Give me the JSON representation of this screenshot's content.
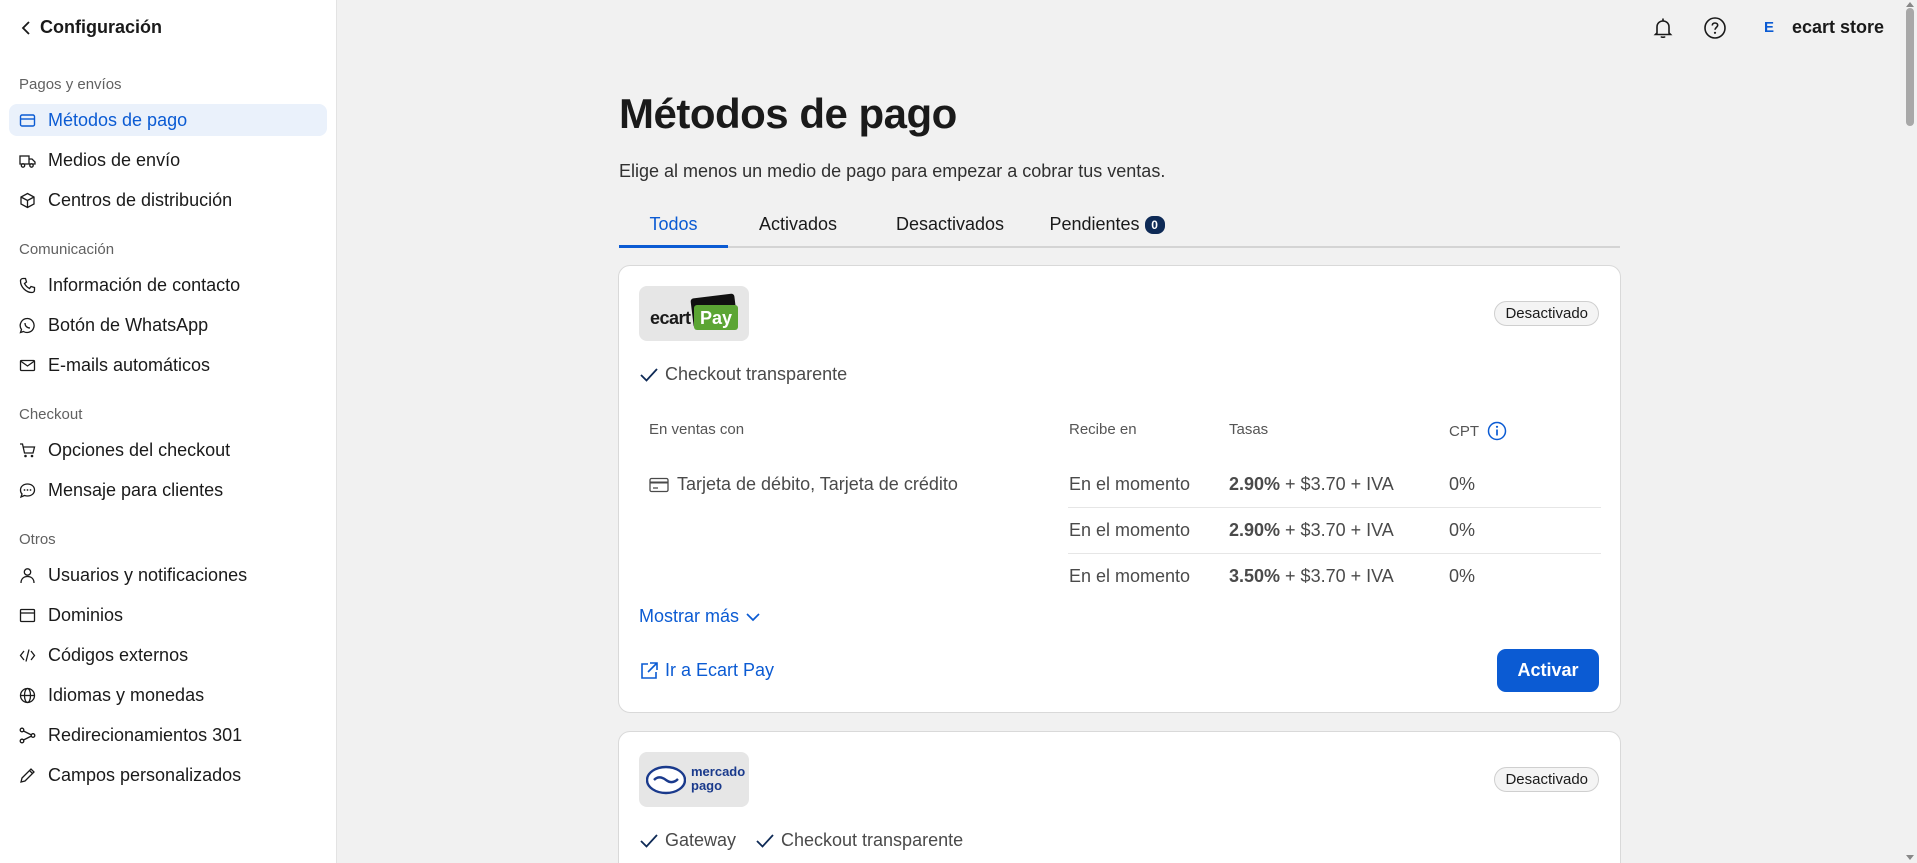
{
  "sidebar": {
    "back_label": "Configuración",
    "sections": [
      {
        "title": "Pagos y envíos",
        "items": [
          {
            "label": "Métodos de pago",
            "icon": "credit-card-icon"
          },
          {
            "label": "Medios de envío",
            "icon": "truck-icon"
          },
          {
            "label": "Centros de distribución",
            "icon": "box-icon"
          }
        ]
      },
      {
        "title": "Comunicación",
        "items": [
          {
            "label": "Información de contacto",
            "icon": "phone-icon"
          },
          {
            "label": "Botón de WhatsApp",
            "icon": "whatsapp-icon"
          },
          {
            "label": "E-mails automáticos",
            "icon": "mail-icon"
          }
        ]
      },
      {
        "title": "Checkout",
        "items": [
          {
            "label": "Opciones del checkout",
            "icon": "cart-icon"
          },
          {
            "label": "Mensaje para clientes",
            "icon": "chat-icon"
          }
        ]
      },
      {
        "title": "Otros",
        "items": [
          {
            "label": "Usuarios y notificaciones",
            "icon": "user-icon"
          },
          {
            "label": "Dominios",
            "icon": "browser-icon"
          },
          {
            "label": "Códigos externos",
            "icon": "code-icon"
          },
          {
            "label": "Idiomas y monedas",
            "icon": "globe-icon"
          },
          {
            "label": "Redirecionamientos 301",
            "icon": "redirect-icon"
          },
          {
            "label": "Campos personalizados",
            "icon": "pencil-icon"
          }
        ]
      }
    ]
  },
  "topbar": {
    "store_initial": "E",
    "store_name": "ecart store"
  },
  "main": {
    "title": "Métodos de pago",
    "subtitle": "Elige al menos un medio de pago para empezar a cobrar tus ventas.",
    "tabs": [
      {
        "label": "Todos"
      },
      {
        "label": "Activados"
      },
      {
        "label": "Desactivados"
      },
      {
        "label": "Pendientes",
        "badge": "0"
      }
    ]
  },
  "cards": [
    {
      "logo_text_a": "ecart",
      "logo_text_b": "Pay",
      "status": "Desactivado",
      "features": [
        "Checkout transparente"
      ],
      "columns": {
        "sales": "En ventas con",
        "receive": "Recibe en",
        "rates": "Tasas",
        "cpt": "CPT"
      },
      "payment_label": "Tarjeta de débito, Tarjeta de crédito",
      "rows": [
        {
          "receive": "En el momento",
          "rate": "2.90%",
          "fee": " + $3.70 + IVA",
          "cpt": "0%"
        },
        {
          "receive": "En el momento",
          "rate": "2.90%",
          "fee": " + $3.70 + IVA",
          "cpt": "0%"
        },
        {
          "receive": "En el momento",
          "rate": "3.50%",
          "fee": " + $3.70 + IVA",
          "cpt": "0%"
        }
      ],
      "show_more": "Mostrar más",
      "link_label": "Ir a Ecart Pay",
      "button_label": "Activar"
    },
    {
      "logo_text_a": "mercado",
      "logo_text_b": "pago",
      "status": "Desactivado",
      "features": [
        "Gateway",
        "Checkout transparente"
      ]
    }
  ],
  "colors": {
    "accent": "#0b5bd3",
    "sidebar_active_bg": "#eaf1fb",
    "ecart_green": "#5ba534"
  }
}
